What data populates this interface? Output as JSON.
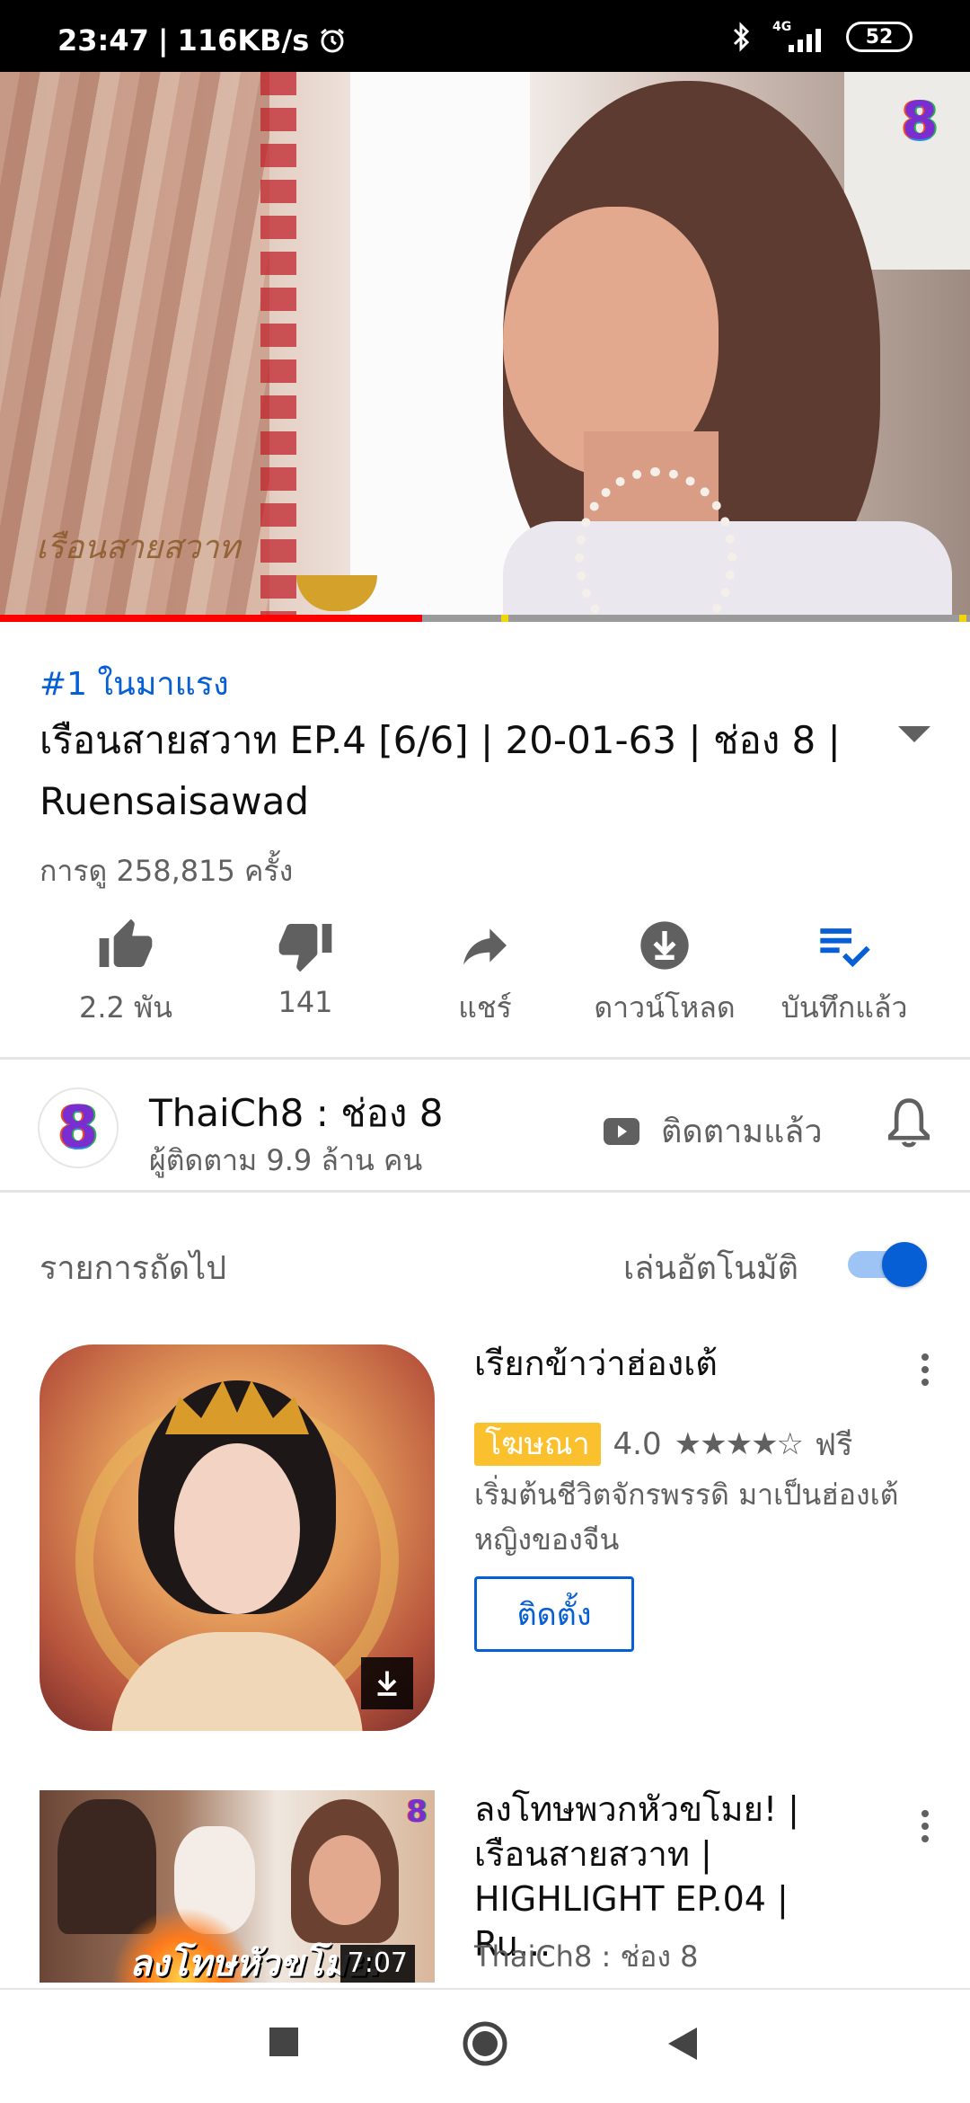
{
  "status_bar": {
    "time": "23:47",
    "speed": "116KB/s",
    "network": "4G",
    "battery": "52"
  },
  "video": {
    "progress": 0.435,
    "watermark": "เรือนสายสวาท"
  },
  "info": {
    "trending": "#1 ในมาแรง",
    "title": "เรือนสายสวาท EP.4 [6/6] | 20-01-63 | ช่อง 8 | Ruensaisawad",
    "views": "การดู 258,815 ครั้ง"
  },
  "actions": {
    "like": "2.2 พัน",
    "dislike": "141",
    "share": "แชร์",
    "download": "ดาวน์โหลด",
    "saved": "บันทึกแล้ว"
  },
  "channel": {
    "name": "ThaiCh8 : ช่อง 8",
    "subscribers": "ผู้ติดตาม 9.9 ล้าน คน",
    "subscribed_label": "ติดตามแล้ว"
  },
  "up_next": {
    "label": "รายการถัดไป",
    "autoplay_label": "เล่นอัตโนมัติ",
    "autoplay_on": true
  },
  "ad": {
    "title": "เรียกข้าว่าฮ่องเต้",
    "badge": "โฆษณา",
    "rating": "4.0",
    "stars": "★★★★☆",
    "price": "ฟรี",
    "description": "เริ่มต้นชีวิตจักรพรรดิ มาเป็นฮ่องเต้หญิงของจีน",
    "install_label": "ติดตั้ง"
  },
  "next_video": {
    "title": "ลงโทษพวกหัวขโมย! | เรือนสายสวาท | HIGHLIGHT EP.04 | Ru...",
    "channel": "ThaiCh8 : ช่อง 8",
    "duration": "7:07",
    "thumb_caption": "ลงโทษหัวขโมย!"
  },
  "colors": {
    "accent_blue": "#065fd4",
    "progress_red": "#ff0000",
    "ad_badge": "#fbc02d"
  }
}
